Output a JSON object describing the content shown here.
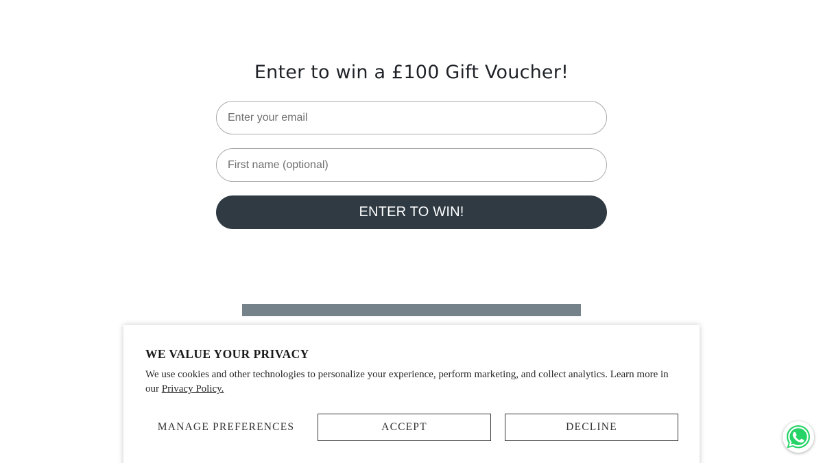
{
  "signup": {
    "headline": "Enter to win a £100 Gift Voucher!",
    "email_placeholder": "Enter your email",
    "email_value": "",
    "name_placeholder": "First name (optional)",
    "name_value": "",
    "submit_label": "ENTER TO WIN!"
  },
  "cookie_banner": {
    "title": "WE VALUE YOUR PRIVACY",
    "body_text": "We use cookies and other technologies to personalize your experience, perform marketing, and collect analytics. Learn more in our ",
    "policy_link_label": "Privacy Policy.",
    "manage_label": "MANAGE PREFERENCES",
    "accept_label": "ACCEPT",
    "decline_label": "DECLINE"
  },
  "chat_widget": {
    "icon": "whatsapp-icon"
  },
  "colors": {
    "button_dark": "#2f3a43",
    "divider_bar": "#76828a",
    "whatsapp_green": "#25d366"
  }
}
